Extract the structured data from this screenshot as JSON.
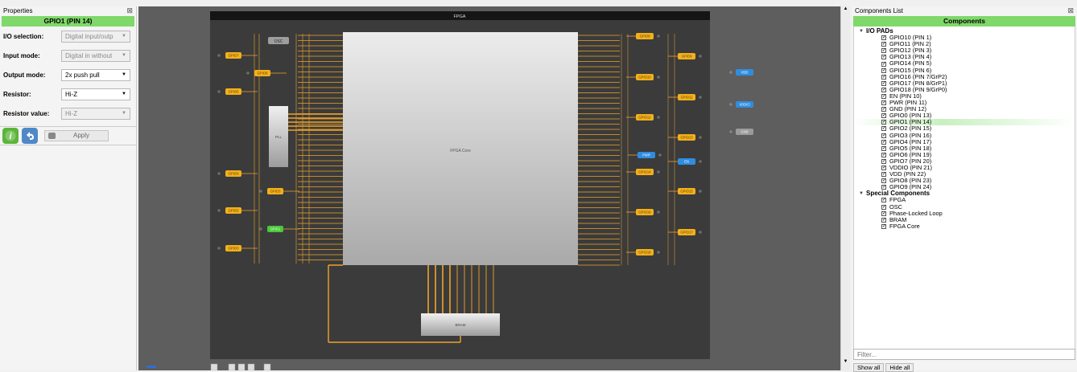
{
  "properties": {
    "pane_title": "Properties",
    "header": "GPIO1 (PIN 14)",
    "rows": [
      {
        "label": "I/O selection:",
        "value": "Digital input/outp",
        "disabled": true
      },
      {
        "label": "Input mode:",
        "value": "Digital in without",
        "disabled": true
      },
      {
        "label": "Output mode:",
        "value": "2x push pull",
        "disabled": false
      },
      {
        "label": "Resistor:",
        "value": "Hi-Z",
        "disabled": false
      },
      {
        "label": "Resistor value:",
        "value": "Hi-Z",
        "disabled": true
      }
    ],
    "apply_label": "Apply"
  },
  "canvas": {
    "board_title": "FPGA",
    "core_label": "FPGA Core",
    "pll_label": "PLL",
    "bram_label": "BRAM",
    "osc_label": "OSC",
    "left_pins": [
      "GPIO7",
      "GPIO8",
      "GPIO5",
      "GPIO4",
      "GPIO3",
      "GPIO2",
      "GPIO1",
      "GPIO0"
    ],
    "right_pins": [
      "GPIO8",
      "GPIO9",
      "GPIO10",
      "GPIO11",
      "GPIO12",
      "GPIO13",
      "PWR",
      "EN",
      "GPIO14",
      "GPIO15",
      "GPIO16",
      "GPIO17",
      "GPIO18"
    ],
    "power_pins": [
      "VDD",
      "VDDIO",
      "GND"
    ],
    "colors": {
      "pin": "#f2b01c",
      "pin_selected": "#48c838",
      "wire": "#f0a32a",
      "blue_pin": "#2f8de0",
      "gray_pin": "#9a9a9a"
    }
  },
  "components": {
    "pane_title": "Components List",
    "header": "Components",
    "groups": [
      {
        "name": "I/O PADs",
        "items": [
          "GPIO10 (PIN 1)",
          "GPIO11 (PIN 2)",
          "GPIO12 (PIN 3)",
          "GPIO13 (PIN 4)",
          "GPIO14 (PIN 5)",
          "GPIO15 (PIN 6)",
          "GPIO16 (PIN 7/GrP2)",
          "GPIO17 (PIN 8/GrP1)",
          "GPIO18 (PIN 9/GrP0)",
          "EN (PIN 10)",
          "PWR (PIN 11)",
          "GND (PIN 12)",
          "GPIO0 (PIN 13)",
          "GPIO1 (PIN 14)",
          "GPIO2 (PIN 15)",
          "GPIO3 (PIN 16)",
          "GPIO4 (PIN 17)",
          "GPIO5 (PIN 18)",
          "GPIO6 (PIN 19)",
          "GPIO7 (PIN 20)",
          "VDDIO (PIN 21)",
          "VDD (PIN 22)",
          "GPIO8 (PIN 23)",
          "GPIO9 (PIN 24)"
        ]
      },
      {
        "name": "Special Components",
        "items": [
          "FPGA",
          "OSC",
          "Phase-Locked Loop",
          "BRAM",
          "FPGA Core"
        ]
      }
    ],
    "selected_item": "GPIO1 (PIN 14)",
    "filter_placeholder": "Filter...",
    "show_all": "Show all",
    "hide_all": "Hide all"
  }
}
